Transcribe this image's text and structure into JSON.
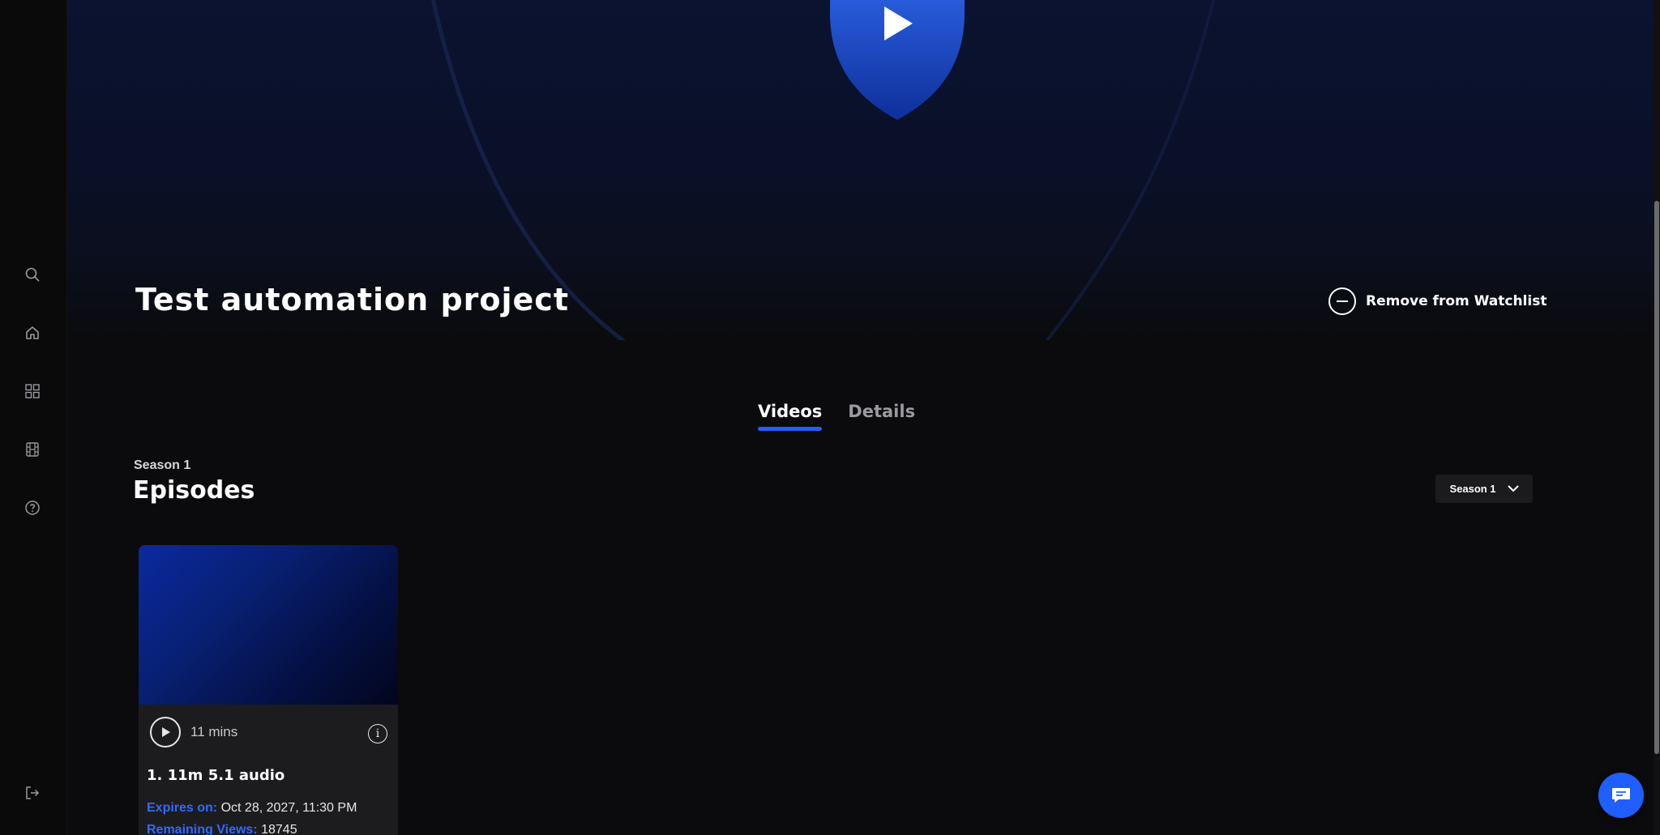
{
  "sidebar": {
    "icons": [
      "search-icon",
      "home-icon",
      "grid-icon",
      "film-icon",
      "help-icon",
      "logout-icon"
    ]
  },
  "hero": {
    "play_icon": "shield-play-icon"
  },
  "title": "Test automation project",
  "watchlist": {
    "label": "Remove from Watchlist",
    "icon": "minus-circle-icon"
  },
  "tabs": [
    {
      "label": "Videos",
      "active": true
    },
    {
      "label": "Details",
      "active": false
    }
  ],
  "season": {
    "small_label": "Season 1",
    "heading": "Episodes",
    "select_value": "Season 1"
  },
  "episodes": [
    {
      "duration": "11 mins",
      "title": "1. 11m 5.1 audio",
      "expires_label": "Expires on:",
      "expires_value": "Oct 28, 2027, 11:30 PM",
      "views_label": "Remaining Views:",
      "views_value": "18745"
    }
  ],
  "colors": {
    "accent": "#1f5eff",
    "background": "#0b0b0d",
    "card": "#1c1c1f"
  }
}
